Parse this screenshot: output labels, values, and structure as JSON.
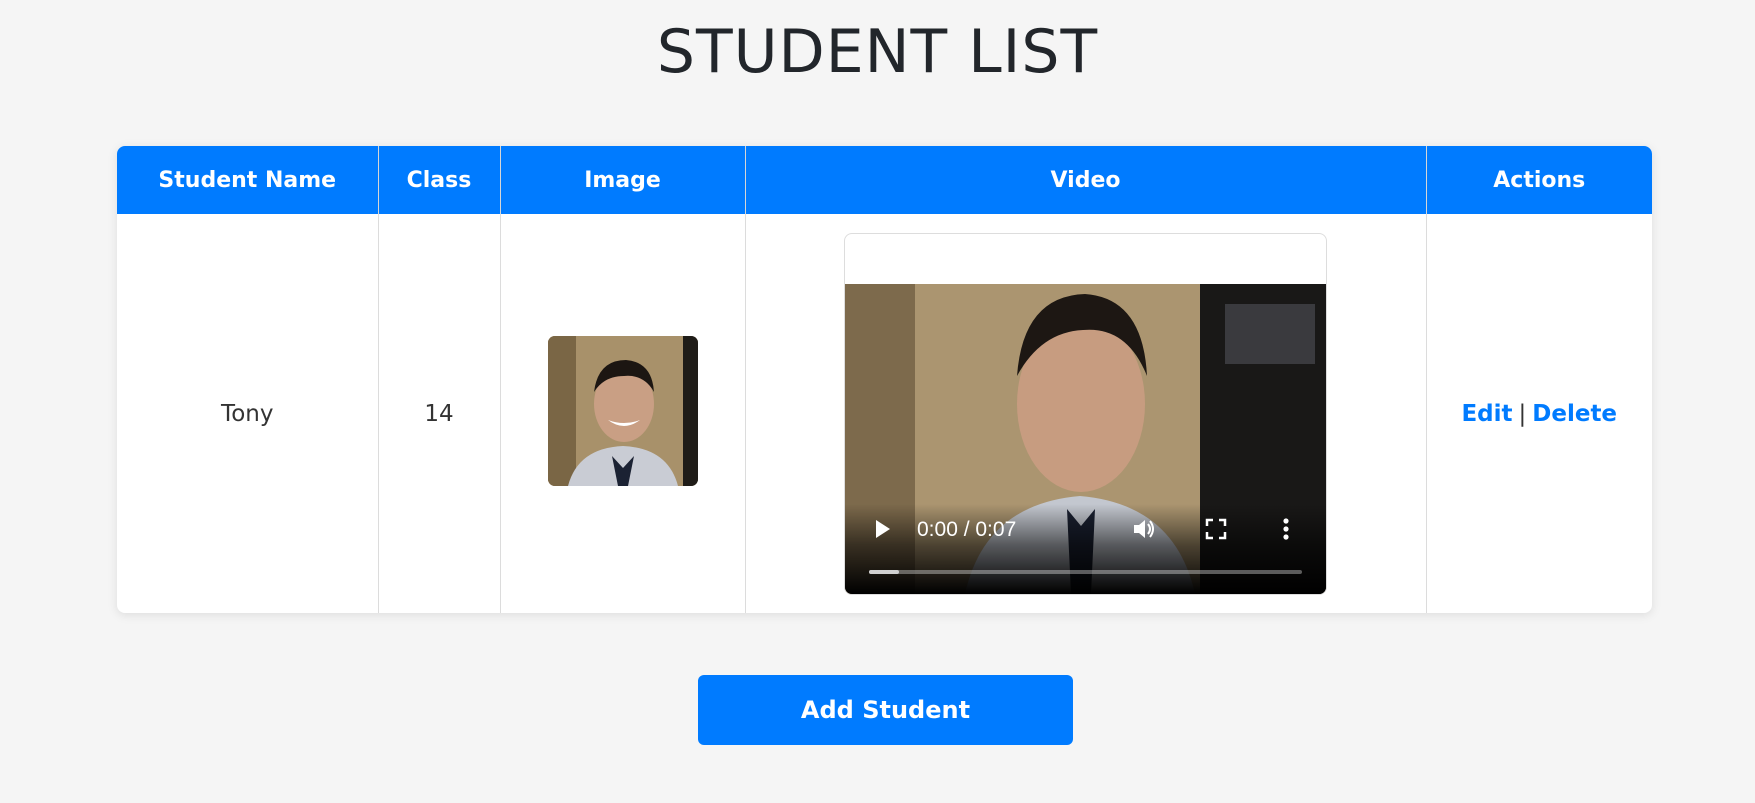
{
  "page": {
    "title": "STUDENT LIST"
  },
  "table": {
    "headers": [
      "Student Name",
      "Class",
      "Image",
      "Video",
      "Actions"
    ],
    "rows": [
      {
        "name": "Tony",
        "class": "14",
        "image_icon": "student-photo",
        "video": {
          "time": "0:00 / 0:07",
          "progress": 0.07,
          "play_icon": "play-icon",
          "volume_icon": "volume-icon",
          "fullscreen_icon": "fullscreen-icon",
          "more_icon": "more-options-icon"
        },
        "actions": {
          "edit": "Edit",
          "separator": "|",
          "delete": "Delete"
        }
      }
    ]
  },
  "add_button": {
    "label": "Add Student"
  },
  "colors": {
    "accent": "#007bff",
    "background": "#f5f5f5"
  }
}
